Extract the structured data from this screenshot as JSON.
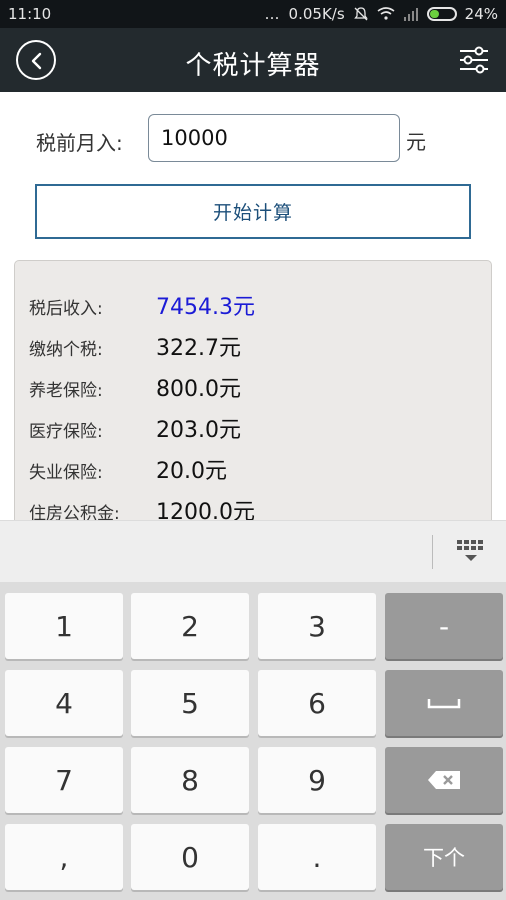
{
  "status_bar": {
    "time": "11:10",
    "network_speed": "0.05K/s",
    "battery": "24%"
  },
  "header": {
    "title": "个税计算器",
    "back_icon": "back-arrow-icon",
    "menu_icon": "settings-sliders-icon"
  },
  "form": {
    "income_label": "税前月入:",
    "income_value": "10000",
    "income_unit": "元",
    "calculate_label": "开始计算"
  },
  "results": [
    {
      "label": "税后收入:",
      "value": "7454.3元"
    },
    {
      "label": "缴纳个税:",
      "value": "322.7元"
    },
    {
      "label": "养老保险:",
      "value": "800.0元"
    },
    {
      "label": "医疗保险:",
      "value": "203.0元"
    },
    {
      "label": "失业保险:",
      "value": "20.0元"
    },
    {
      "label": "住房公积金:",
      "value": "1200.0元"
    }
  ],
  "colors": {
    "accent_blue": "#1b1bd6",
    "titlebar": "#232a2e",
    "button_border": "#2f6a94"
  },
  "keyboard": {
    "keys": [
      "1",
      "2",
      "3",
      "-",
      "4",
      "5",
      "6",
      "␣",
      "7",
      "8",
      "9",
      "⌫",
      ",",
      "0",
      ".",
      "下个"
    ]
  }
}
